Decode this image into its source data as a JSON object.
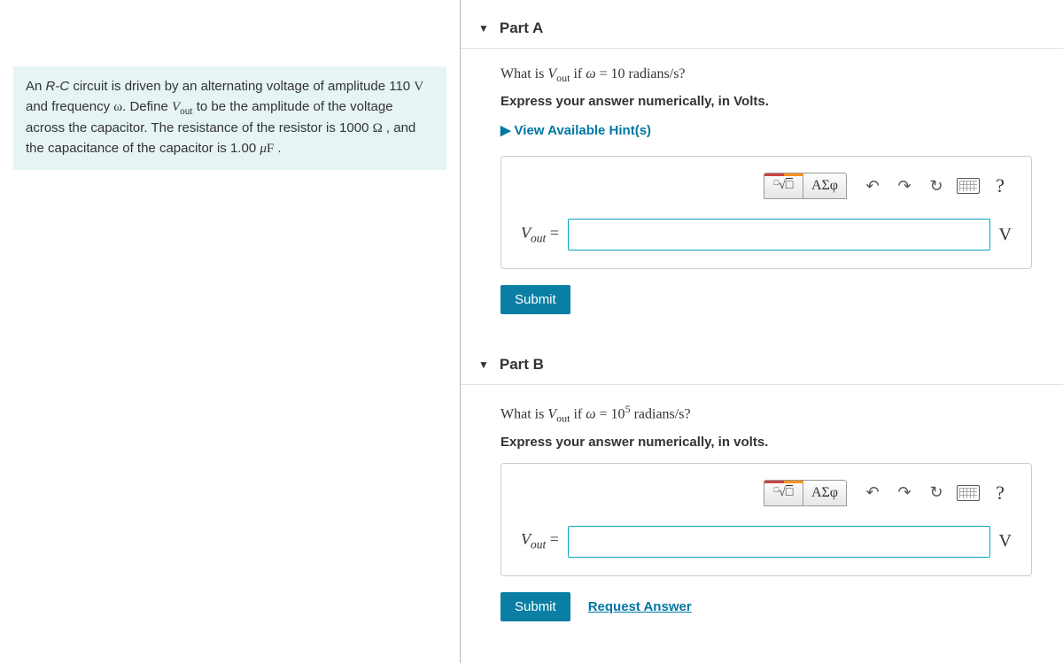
{
  "problem": {
    "html": "An <i>R-C</i> circuit is driven by an alternating voltage of amplitude 110 <span class='math'>V</span> and frequency <span class='math'>ω</span>. Define <span class='math'><i>V</i><sub>out</sub></span> to be the amplitude of the voltage across the capacitor. The resistance of the resistor is 1000 <span class='math'>Ω</span> , and the capacitance of the capacitor is 1.00 <span class='math'><i>μ</i>F</span> ."
  },
  "parts": {
    "a": {
      "title": "Part A",
      "question_html": "What is <i>V</i><sub>out</sub> if <i>ω</i> = 10 radians/s?",
      "instruction": "Express your answer numerically, in Volts.",
      "hints_label": "View Available Hint(s)",
      "var_label": "V",
      "var_sub": "out",
      "eq": " = ",
      "unit": "V",
      "submit": "Submit",
      "greek": "ΑΣφ",
      "help": "?"
    },
    "b": {
      "title": "Part B",
      "question_html": "What is <i>V</i><sub>out</sub> if <i>ω</i> = 10<sup>5</sup> radians/s?",
      "instruction": "Express your answer numerically, in volts.",
      "var_label": "V",
      "var_sub": "out",
      "eq": " = ",
      "unit": "V",
      "submit": "Submit",
      "request": "Request Answer",
      "greek": "ΑΣφ",
      "help": "?"
    }
  }
}
